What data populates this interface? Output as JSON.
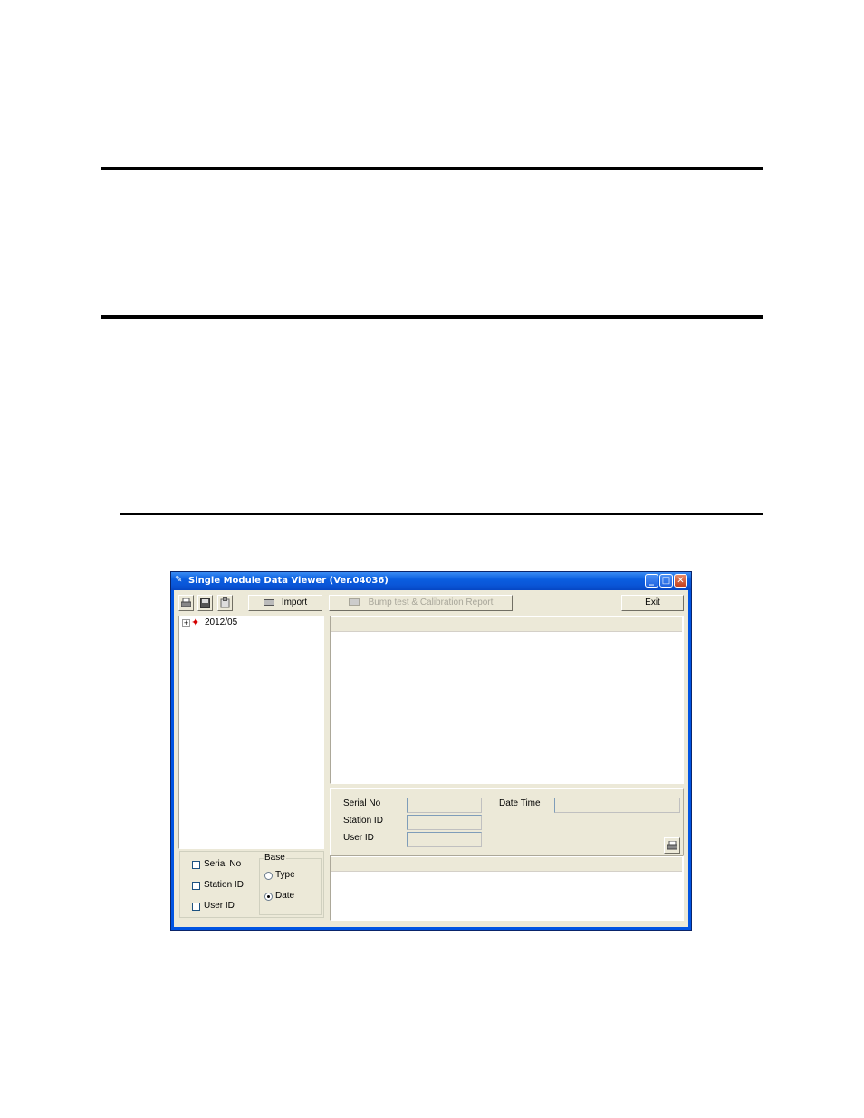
{
  "window": {
    "title": "Single Module Data Viewer (Ver.04036)",
    "min_glyph": "_",
    "max_glyph": "□",
    "close_glyph": "✕"
  },
  "toolbar": {
    "import_label": "Import",
    "report_label": "Bump test & Calibration Report",
    "exit_label": "Exit"
  },
  "tree": {
    "expander": "+",
    "node_label": "2012/05"
  },
  "filters": {
    "serial_no": "Serial No",
    "station_id": "Station ID",
    "user_id": "User ID"
  },
  "base": {
    "group_label": "Base",
    "type_label": "Type",
    "date_label": "Date",
    "selected": "Date"
  },
  "details": {
    "serial_no_label": "Serial No",
    "station_id_label": "Station ID",
    "user_id_label": "User ID",
    "date_time_label": "Date Time",
    "serial_no_value": "",
    "station_id_value": "",
    "user_id_value": "",
    "date_time_value": ""
  },
  "icons": {
    "print": "print-icon",
    "save": "save-icon",
    "clipboard": "clipboard-icon",
    "import": "import-icon",
    "tree_node": "folder-star-icon"
  }
}
